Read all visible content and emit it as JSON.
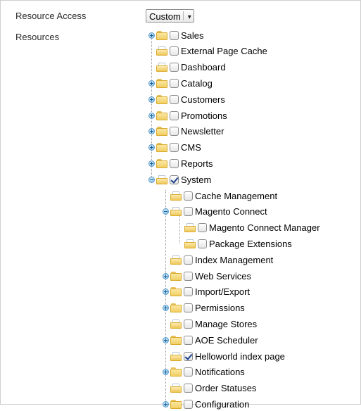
{
  "labels": {
    "resource_access": "Resource Access",
    "resources": "Resources"
  },
  "resource_access_select": {
    "value": "Custom",
    "arrow": "▾"
  },
  "tree": [
    {
      "label": "Sales",
      "icon": "folder-closed-icon",
      "expander": "plus",
      "checked": false
    },
    {
      "label": "External Page Cache",
      "icon": "folder-open-icon",
      "expander": "none",
      "checked": false
    },
    {
      "label": "Dashboard",
      "icon": "folder-open-icon",
      "expander": "none",
      "checked": false
    },
    {
      "label": "Catalog",
      "icon": "folder-closed-icon",
      "expander": "plus",
      "checked": false
    },
    {
      "label": "Customers",
      "icon": "folder-closed-icon",
      "expander": "plus",
      "checked": false
    },
    {
      "label": "Promotions",
      "icon": "folder-closed-icon",
      "expander": "plus",
      "checked": false
    },
    {
      "label": "Newsletter",
      "icon": "folder-closed-icon",
      "expander": "plus",
      "checked": false
    },
    {
      "label": "CMS",
      "icon": "folder-closed-icon",
      "expander": "plus",
      "checked": false
    },
    {
      "label": "Reports",
      "icon": "folder-closed-icon",
      "expander": "plus",
      "checked": false
    },
    {
      "label": "System",
      "icon": "folder-open-icon",
      "expander": "minus",
      "checked": true
    },
    {
      "label": "Cache Management",
      "icon": "folder-open-icon",
      "expander": "none",
      "checked": false
    },
    {
      "label": "Magento Connect",
      "icon": "folder-open-icon",
      "expander": "minus",
      "checked": false
    },
    {
      "label": "Magento Connect Manager",
      "icon": "folder-open-icon",
      "expander": "none",
      "checked": false
    },
    {
      "label": "Package Extensions",
      "icon": "folder-open-icon",
      "expander": "none",
      "checked": false
    },
    {
      "label": "Index Management",
      "icon": "folder-open-icon",
      "expander": "none",
      "checked": false
    },
    {
      "label": "Web Services",
      "icon": "folder-closed-icon",
      "expander": "plus",
      "checked": false
    },
    {
      "label": "Import/Export",
      "icon": "folder-closed-icon",
      "expander": "plus",
      "checked": false
    },
    {
      "label": "Permissions",
      "icon": "folder-closed-icon",
      "expander": "plus",
      "checked": false
    },
    {
      "label": "Manage Stores",
      "icon": "folder-open-icon",
      "expander": "none",
      "checked": false
    },
    {
      "label": "AOE Scheduler",
      "icon": "folder-closed-icon",
      "expander": "plus",
      "checked": false
    },
    {
      "label": "Helloworld index page",
      "icon": "folder-open-icon",
      "expander": "none",
      "checked": true
    },
    {
      "label": "Notifications",
      "icon": "folder-closed-icon",
      "expander": "plus",
      "checked": false
    },
    {
      "label": "Order Statuses",
      "icon": "folder-open-icon",
      "expander": "none",
      "checked": false
    },
    {
      "label": "Configuration",
      "icon": "folder-closed-icon",
      "expander": "plus",
      "checked": false
    }
  ]
}
